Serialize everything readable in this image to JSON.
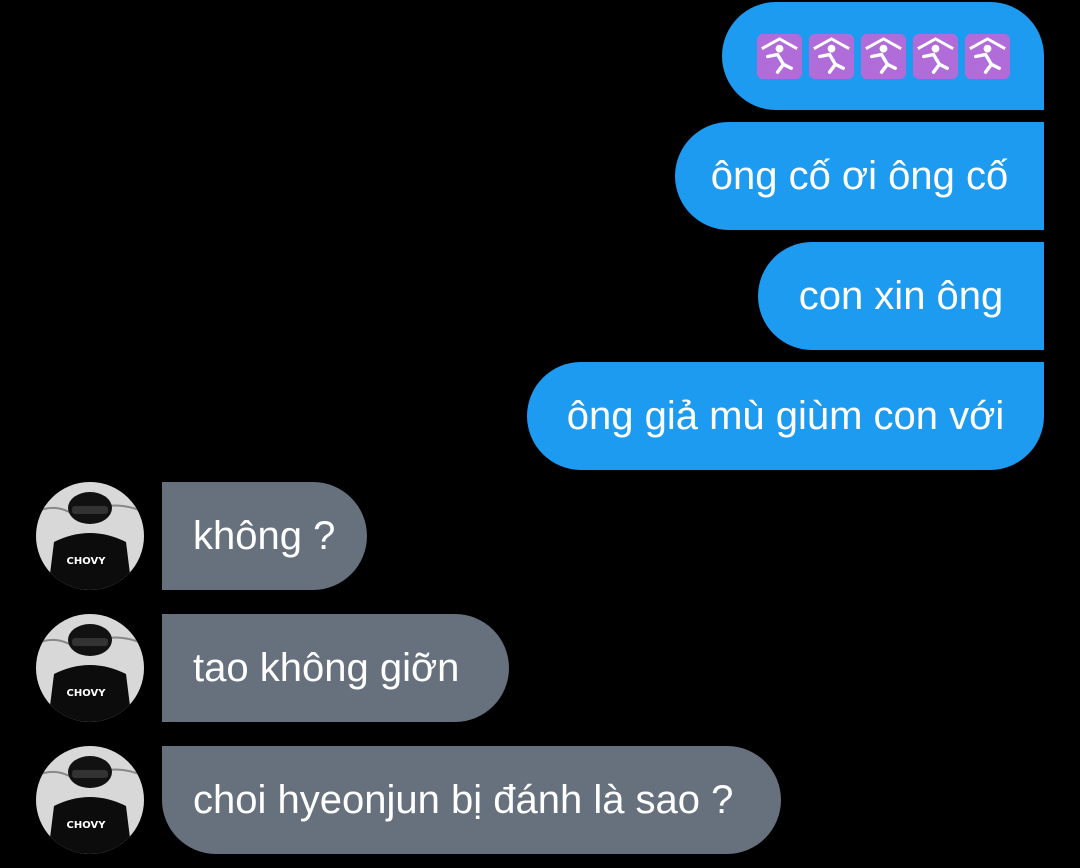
{
  "messages_sent": [
    {
      "type": "emoji",
      "emoji_name": "person-praying-icon",
      "count": 5
    },
    {
      "text": "ông cố ơi ông cố"
    },
    {
      "text": "con xin ông"
    },
    {
      "text": "ông giả mù giùm con với"
    }
  ],
  "messages_received": [
    {
      "text": "không ?"
    },
    {
      "text": "tao không giỡn"
    },
    {
      "text": "choi hyeonjun bị đánh là sao ?"
    }
  ],
  "avatar": {
    "jersey_text": "CHOVY",
    "icon": "user-avatar"
  },
  "colors": {
    "background": "#000000",
    "sent_bubble": "#1d9bf0",
    "received_bubble": "#67717d",
    "text": "#ffffff"
  }
}
